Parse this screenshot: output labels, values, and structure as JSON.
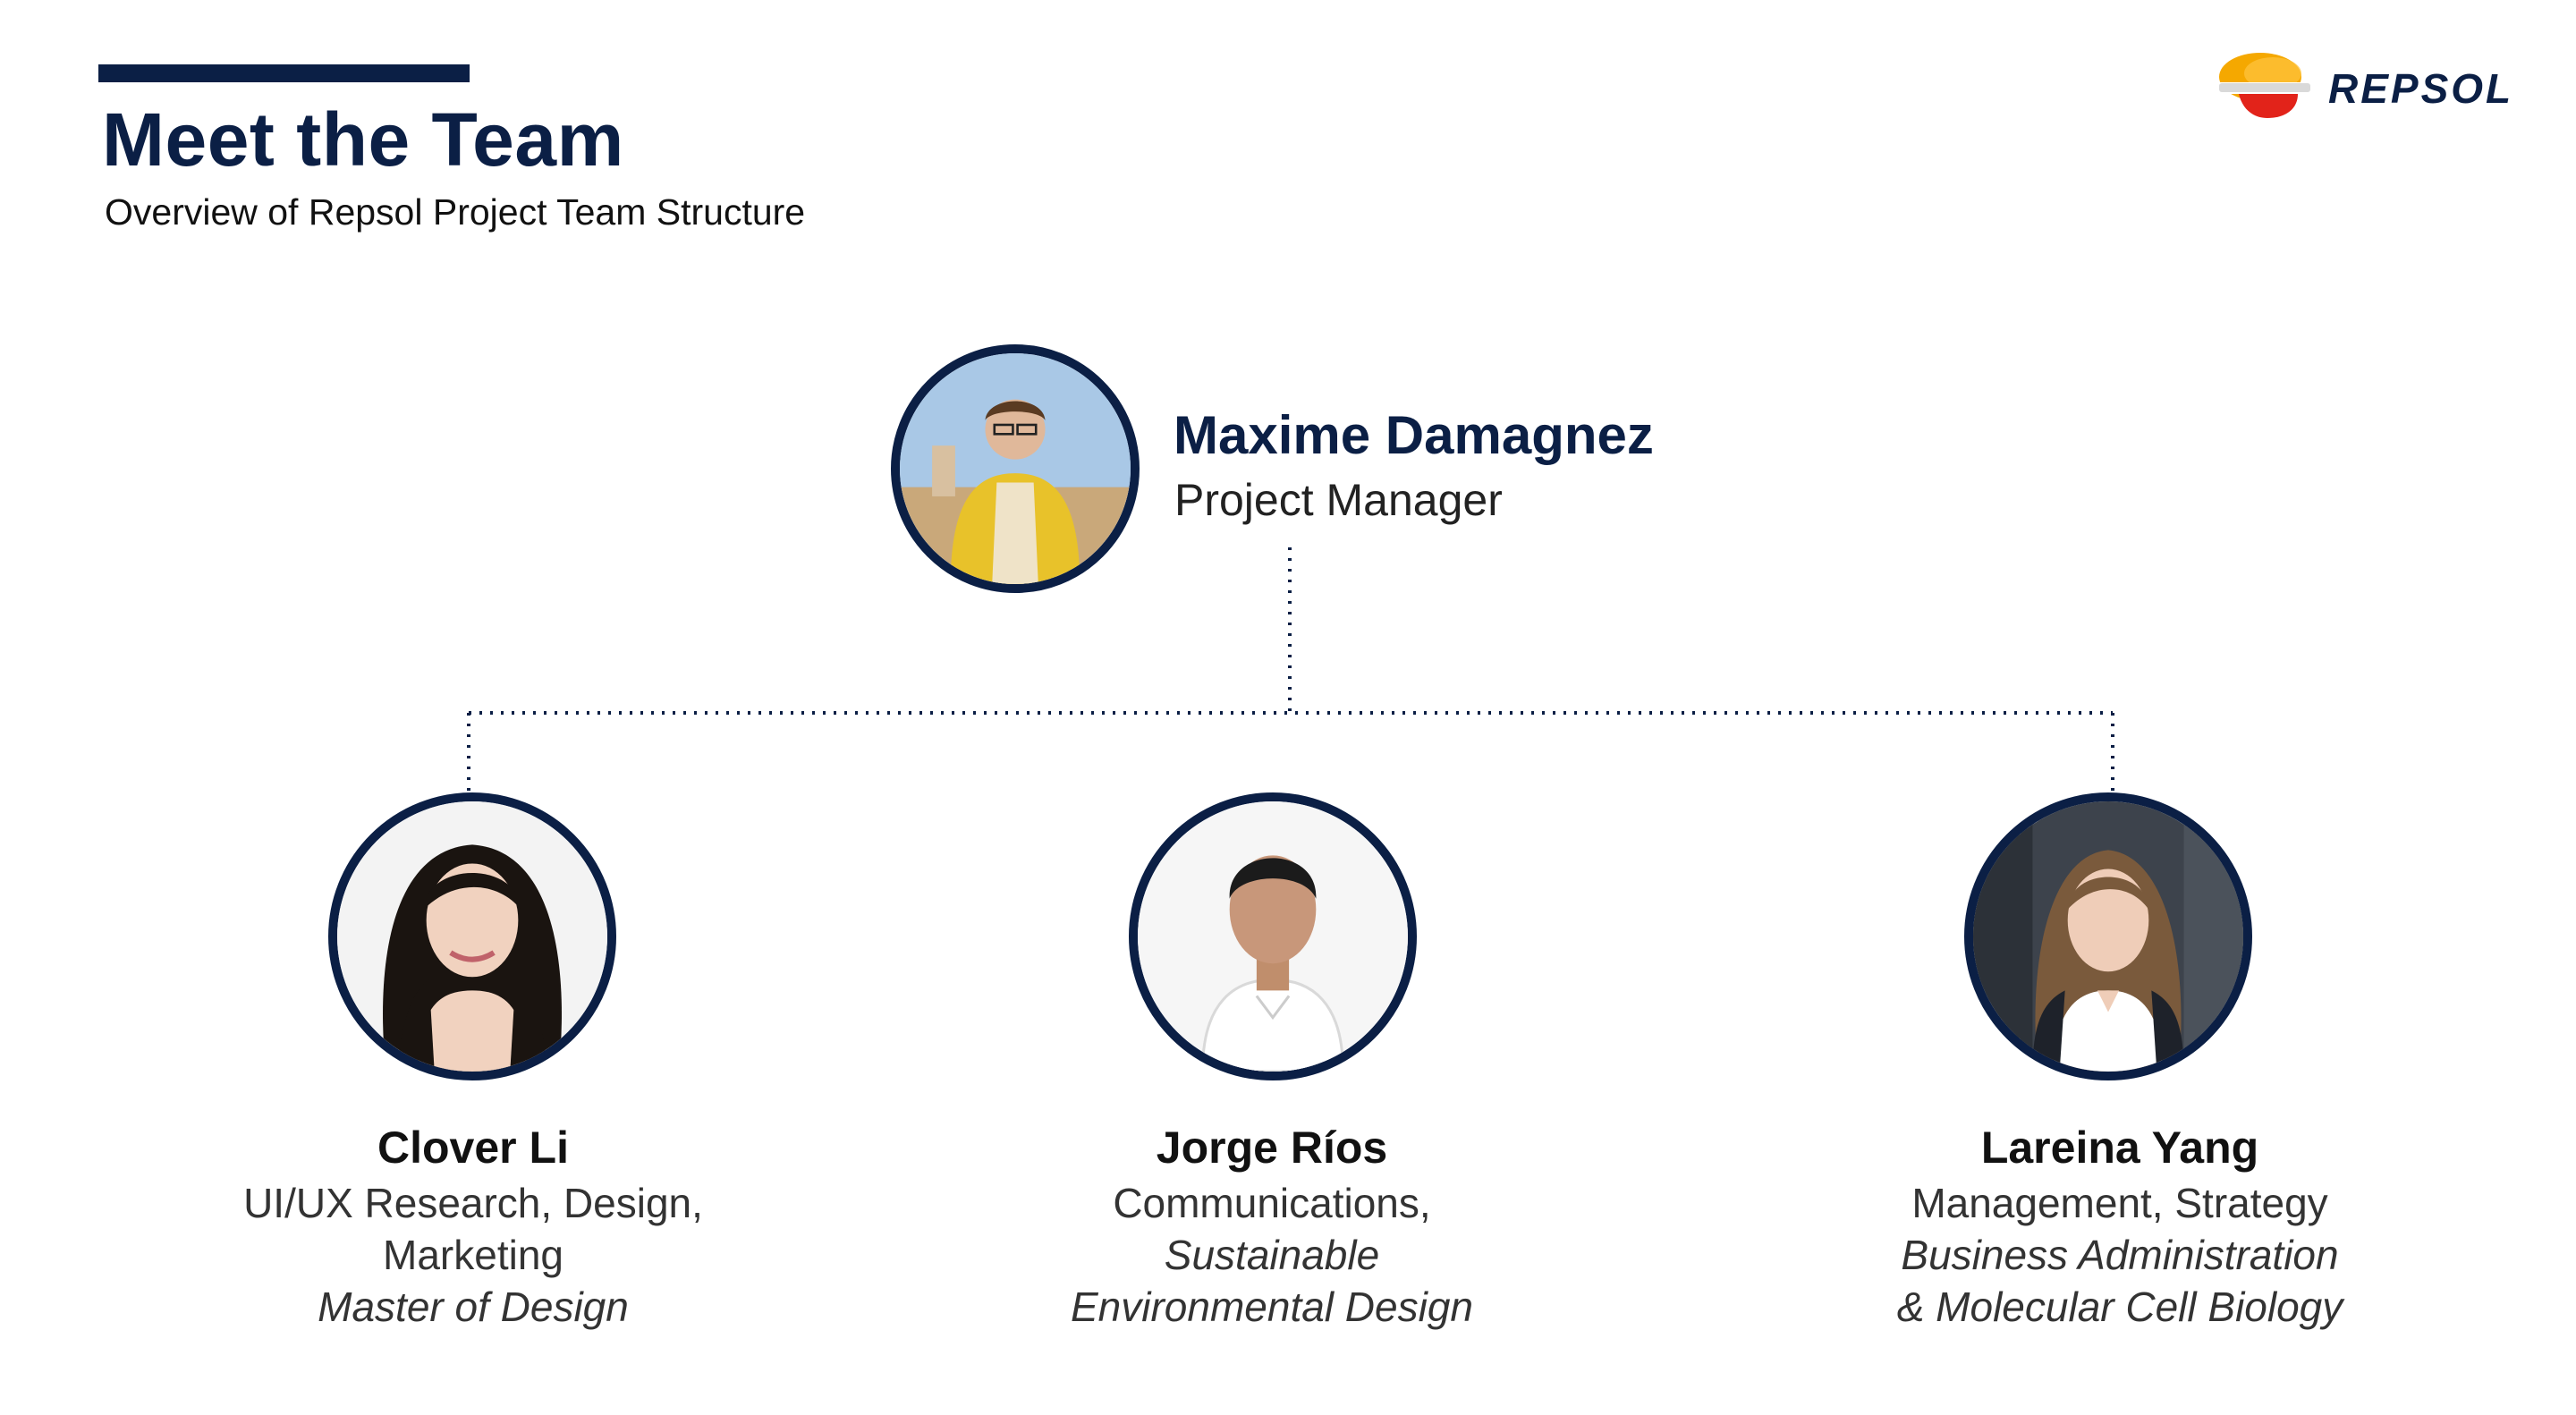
{
  "header": {
    "title": "Meet the Team",
    "subtitle": "Overview of Repsol Project Team Structure"
  },
  "logo": {
    "text": "REPSOL",
    "colors": [
      "#f5a800",
      "#e2231a",
      "#0b1f45"
    ]
  },
  "manager": {
    "name": "Maxime Damagnez",
    "role": "Project Manager",
    "photo": "portrait-man-yellow-jacket"
  },
  "members": [
    {
      "name": "Clover Li",
      "lines": [
        "UI/UX Research, Design,",
        "Marketing"
      ],
      "italic_lines": [
        "Master of Design"
      ],
      "photo": "portrait-woman-dark-hair"
    },
    {
      "name": "Jorge Ríos",
      "lines": [
        "Communications,"
      ],
      "italic_lines": [
        "Sustainable",
        "Environmental Design"
      ],
      "photo": "portrait-man-white-shirt"
    },
    {
      "name": "Lareina Yang",
      "lines": [
        "Management, Strategy"
      ],
      "italic_lines": [
        "Business Administration",
        "& Molecular Cell Biology"
      ],
      "photo": "portrait-woman-white-shirt"
    }
  ],
  "colors": {
    "navy": "#0b1f45",
    "text_dark": "#111111",
    "text_light": "#333333"
  }
}
